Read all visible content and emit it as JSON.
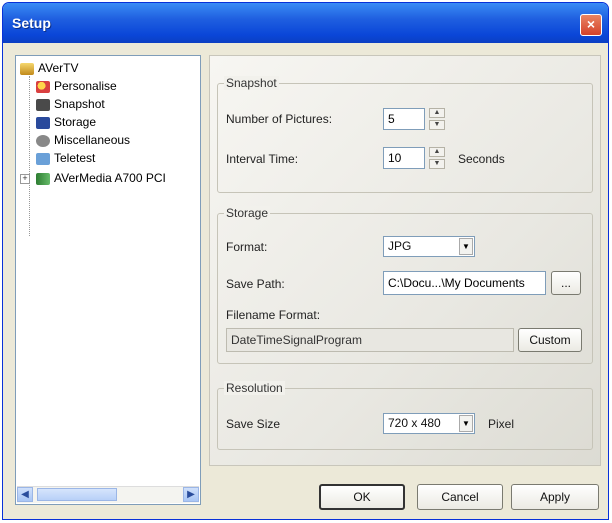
{
  "window": {
    "title": "Setup",
    "close_label": "×"
  },
  "tree": {
    "root": "AVerTV",
    "items": [
      {
        "label": "Personalise",
        "icon": "personalise-icon",
        "color": "#d94040"
      },
      {
        "label": "Snapshot",
        "icon": "camera-icon",
        "color": "#4a4a4a"
      },
      {
        "label": "Storage",
        "icon": "floppy-disk-icon",
        "color": "#2a4a9c"
      },
      {
        "label": "Miscellaneous",
        "icon": "wrench-icon",
        "color": "#777777"
      },
      {
        "label": "Teletest",
        "icon": "teletext-icon",
        "color": "#6aa0d8"
      }
    ],
    "device": "AVerMedia A700 PCI",
    "expander": "+",
    "scroll_left": "◀",
    "scroll_right": "▶"
  },
  "snapshot": {
    "group_label": "Snapshot",
    "number_label": "Number of Pictures:",
    "number_value": "5",
    "interval_label": "Interval Time:",
    "interval_value": "10",
    "interval_unit": "Seconds"
  },
  "storage": {
    "group_label": "Storage",
    "format_label": "Format:",
    "format_value": "JPG",
    "path_label": "Save Path:",
    "path_value": "C:\\Docu...\\My Documents",
    "browse_label": "...",
    "filename_label": "Filename Format:",
    "filename_value": "DateTimeSignalProgram",
    "custom_label": "Custom"
  },
  "resolution": {
    "group_label": "Resolution",
    "size_label": "Save Size",
    "size_value": "720 x 480",
    "size_unit": "Pixel"
  },
  "buttons": {
    "ok": "OK",
    "cancel": "Cancel",
    "apply": "Apply"
  },
  "spin_up": "▲",
  "spin_down": "▼",
  "dropdown_arrow": "▼"
}
